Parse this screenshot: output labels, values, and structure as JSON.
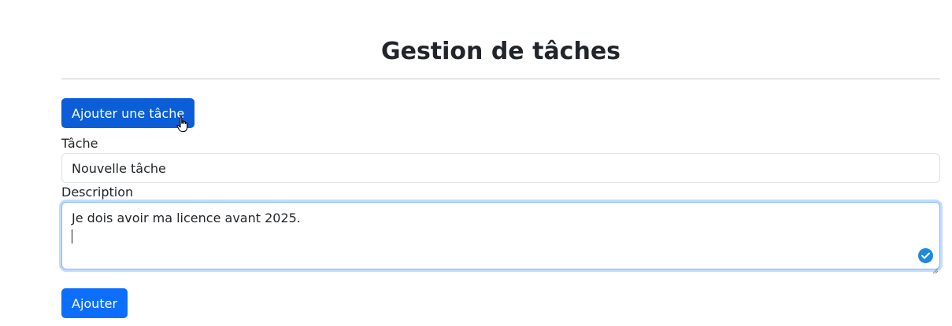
{
  "header": {
    "title": "Gestion de tâches"
  },
  "toolbar": {
    "add_task_label": "Ajouter une tâche"
  },
  "form": {
    "task_label": "Tâche",
    "task_value": "Nouvelle tâche",
    "description_label": "Description",
    "description_value": "Je dois avoir ma licence avant 2025.",
    "submit_label": "Ajouter"
  },
  "colors": {
    "primary_button": "#0d6efd",
    "primary_button_hover": "#0b5ed7",
    "focus_border": "#86b7fe",
    "check_badge": "#1e88e5"
  },
  "icons": {
    "cursor": "hand-pointer-icon",
    "check": "check-circle-icon",
    "resize": "resize-handle-icon"
  }
}
